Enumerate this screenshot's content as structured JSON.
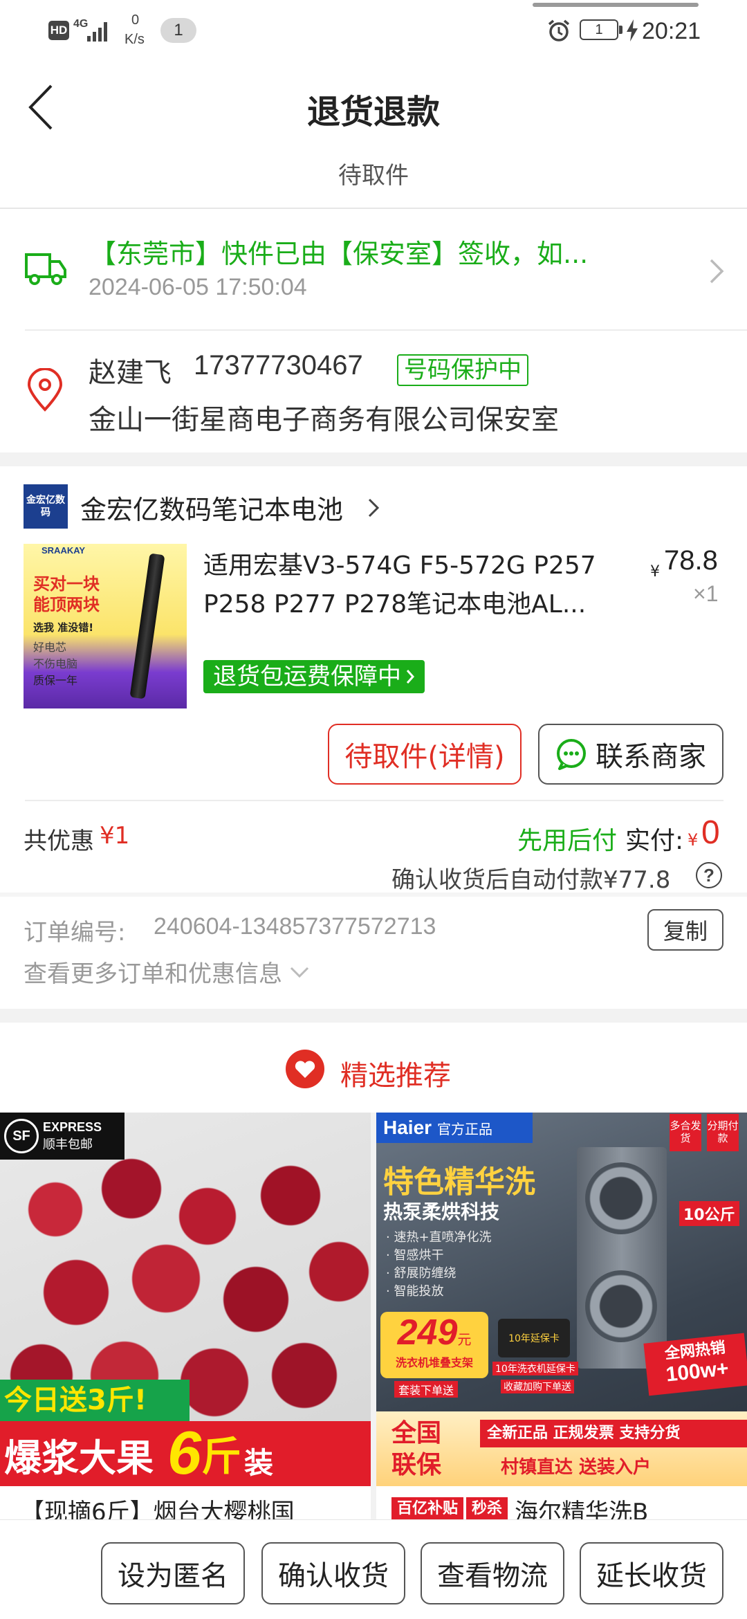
{
  "status": {
    "network": "4G",
    "hd": "HD",
    "speed_value": "0",
    "speed_unit": "K/s",
    "notification_count": "1",
    "battery": "1",
    "time": "20:21"
  },
  "header": {
    "title": "退货退款",
    "subtitle": "待取件"
  },
  "logistics": {
    "message": "【东莞市】快件已由【保安室】签收，如...",
    "time": "2024-06-05 17:50:04"
  },
  "address": {
    "name": "赵建飞",
    "phone": "17377730467",
    "protect_badge": "号码保护中",
    "detail": "金山一街星商电子商务有限公司保安室"
  },
  "shop": {
    "logo_text": "金宏亿数码",
    "name": "金宏亿数码笔记本电池"
  },
  "product": {
    "title": "适用宏基V3-574G F5-572G P257 P258 P277 P278笔记本电池AL...",
    "currency": "¥",
    "price": "78.8",
    "quantity": "×1",
    "guarantee": "退货包运费保障中",
    "img_brand": "SRAAKAY",
    "img_line1": "买对一块",
    "img_line2": "能顶两块",
    "img_line3": "选我 准没错!",
    "img_line4": "好电芯",
    "img_line5": "不伤电脑",
    "img_line6": "质保一年"
  },
  "actions": {
    "pickup_detail": "待取件(详情)",
    "contact_seller": "联系商家"
  },
  "summary": {
    "discount_label": "共优惠",
    "discount_value": "¥1",
    "pay_later": "先用后付",
    "paid_label": "实付:",
    "paid_currency": "¥",
    "paid_value": "0",
    "auto_pay_note": "确认收货后自动付款¥77.8",
    "help_icon": "?"
  },
  "order": {
    "id_label": "订单编号:",
    "id_value": "240604-134857377572713",
    "copy_label": "复制",
    "more_label": "查看更多订单和优惠信息"
  },
  "recommend": {
    "title": "精选推荐",
    "items": [
      {
        "badge_sf": "SF",
        "badge_express": "EXPRESS",
        "badge_free": "顺丰包邮",
        "promo1": "今日送3斤!",
        "promo2a": "爆浆大果",
        "promo2b": "6",
        "promo2c": "斤",
        "promo2d": "装",
        "caption": "【现摘6斤】烟台大樱桃国"
      },
      {
        "brand": "Haier",
        "official": "官方正品",
        "tag1": "多合发货",
        "tag2": "分期付款",
        "headline": "特色精华洗",
        "sub": "热泵柔烘科技",
        "feature1": "· 速热+直喷净化洗",
        "feature2": "· 智感烘干",
        "feature3": "· 舒展防缠绕",
        "feature4": "· 智能投放",
        "price": "249",
        "price_unit": "元",
        "price_note": "洗衣机堆叠支架",
        "price_note2": "套装下单送",
        "card_text": "10年延保卡",
        "card_note": "10年洗衣机延保卡",
        "card_note2": "收藏加购下单送",
        "weight": "10公斤",
        "hot": "全网热销",
        "hot_num": "100w+",
        "guarantee1": "全国",
        "guarantee2": "联保",
        "strip1": "全新正品  正规发票  支持分货",
        "strip2": "村镇直达  送装入户",
        "tag_red1": "百亿补贴",
        "tag_red2": "秒杀",
        "caption": "海尔精华洗B"
      }
    ]
  },
  "bottom": {
    "anonymous": "设为匿名",
    "confirm_receipt": "确认收货",
    "view_logistics": "查看物流",
    "extend_receipt": "延长收货"
  },
  "colors": {
    "green": "#1aad19",
    "red": "#e02e24",
    "text": "#222222",
    "muted": "#8a8a8a"
  }
}
